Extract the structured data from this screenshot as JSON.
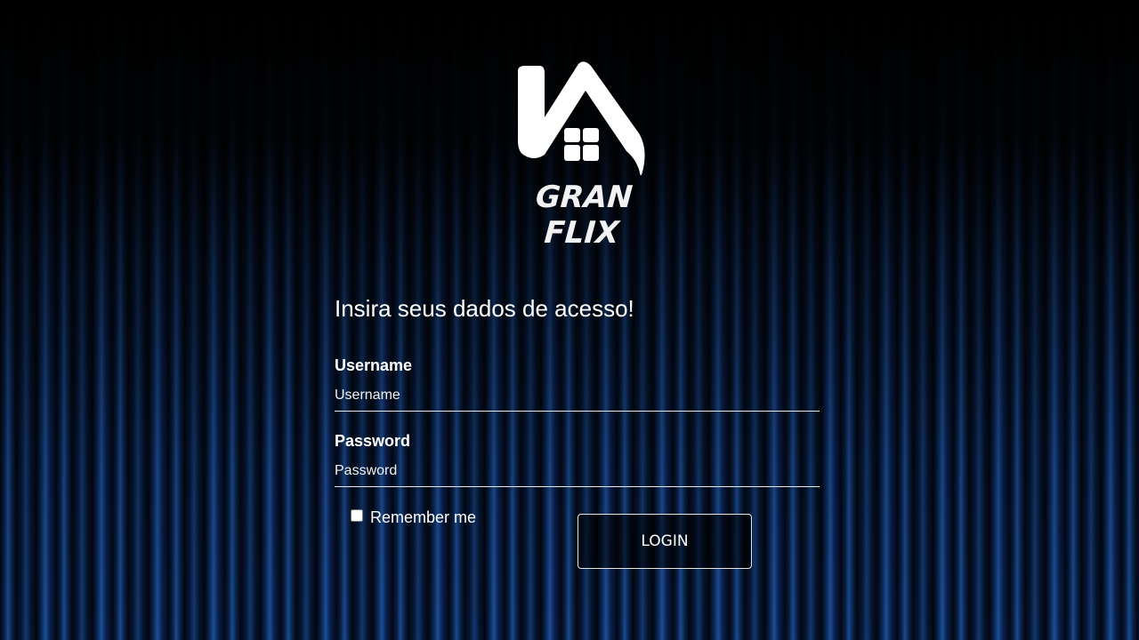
{
  "brand": {
    "name": "GRAN FLIX",
    "logo_icon": "house-logo-icon"
  },
  "login": {
    "heading": "Insira seus dados de acesso!",
    "username_label": "Username",
    "username_placeholder": "Username",
    "username_value": "",
    "password_label": "Password",
    "password_placeholder": "Password",
    "password_value": "",
    "remember_label": "Remember me",
    "remember_checked": false,
    "submit_label": "LOGIN"
  },
  "colors": {
    "background": "#03060c",
    "curtain_blue": "#1a4a8f",
    "text": "#ffffff"
  }
}
